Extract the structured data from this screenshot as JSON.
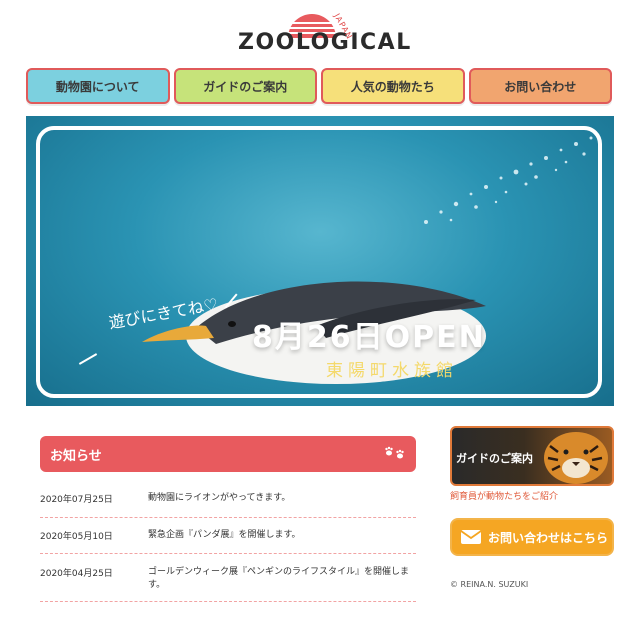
{
  "logo": {
    "wordmark": "ZOOLOGICAL",
    "japan": "JAPAN"
  },
  "nav": [
    {
      "label": "動物園について",
      "color": "#7cd0df"
    },
    {
      "label": "ガイドのご案内",
      "color": "#c6e37a"
    },
    {
      "label": "人気の動物たち",
      "color": "#f6e07a"
    },
    {
      "label": "お問い合わせ",
      "color": "#f1a56f"
    }
  ],
  "hero": {
    "tagline": "遊びにきてね♡",
    "open_text": "8月26日OPEN",
    "venue": "東陽町水族館"
  },
  "news": {
    "title": "お知らせ",
    "items": [
      {
        "date": "2020年07月25日",
        "text": "動物園にライオンがやってきます。"
      },
      {
        "date": "2020年05月10日",
        "text": "緊急企画『パンダ展』を開催します。"
      },
      {
        "date": "2020年04月25日",
        "text": "ゴールデンウィーク展『ペンギンのライフスタイル』を開催します。"
      }
    ]
  },
  "sidebar": {
    "guide_label": "ガイドのご案内",
    "guide_caption": "飼育員が動物たちをご紹介",
    "contact_label": "お問い合わせはこちら",
    "copyright": "© REINA.N. SUZUKI"
  },
  "colors": {
    "accent": "#e85a5e",
    "contact": "#f5a623"
  }
}
